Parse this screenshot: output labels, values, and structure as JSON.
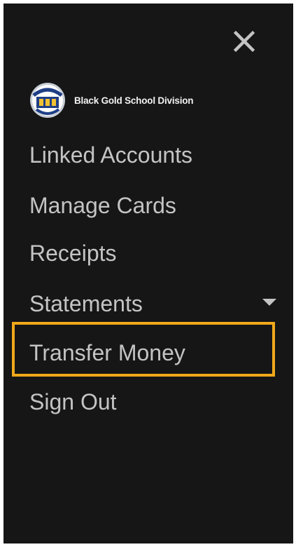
{
  "menu": {
    "close_icon": "close-icon",
    "organization_name": "Black Gold School Division",
    "logo_icon": "school-division-crest-icon",
    "items": [
      {
        "label": "Linked Accounts"
      },
      {
        "label": "Manage Cards"
      },
      {
        "label": "Receipts"
      },
      {
        "label": "Statements",
        "has_dropdown": true,
        "dropdown_icon": "caret-down-icon"
      },
      {
        "label": "Transfer Money",
        "highlighted": true
      },
      {
        "label": "Sign Out"
      }
    ]
  },
  "colors": {
    "panel_background": "#161616",
    "text": "#c4c4c4",
    "highlight": "#f0a81a"
  }
}
